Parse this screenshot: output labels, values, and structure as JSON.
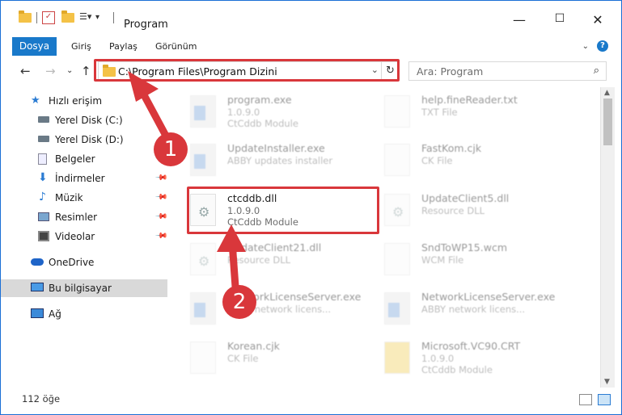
{
  "window": {
    "title": "Program",
    "minimize_icon": "minimize-icon",
    "maximize_icon": "maximize-icon",
    "close_icon": "close-icon"
  },
  "ribbon": {
    "tabs": [
      "Dosya",
      "Giriş",
      "Paylaş",
      "Görünüm"
    ],
    "help": "?"
  },
  "navbar": {
    "address": "C:\\Program Files\\Program Dizini",
    "search_placeholder": "Ara: Program"
  },
  "sidebar": {
    "items": [
      {
        "label": "Hızlı erişim",
        "icon": "star-icon"
      },
      {
        "label": "Yerel Disk (C:)",
        "icon": "drive-icon"
      },
      {
        "label": "Yerel Disk (D:)",
        "icon": "drive-icon"
      },
      {
        "label": "Belgeler",
        "icon": "documents-icon"
      },
      {
        "label": "İndirmeler",
        "icon": "download-icon"
      },
      {
        "label": "Müzik",
        "icon": "music-icon"
      },
      {
        "label": "Resimler",
        "icon": "pictures-icon"
      },
      {
        "label": "Videolar",
        "icon": "video-icon"
      },
      {
        "label": "OneDrive",
        "icon": "cloud-icon"
      },
      {
        "label": "Bu bilgisayar",
        "icon": "computer-icon"
      },
      {
        "label": "Ağ",
        "icon": "network-icon"
      }
    ]
  },
  "files": [
    {
      "name": "program.exe",
      "line1": "1.0.9.0",
      "line2": "CtCddb Module"
    },
    {
      "name": "help.fineReader.txt",
      "line1": "TXT File",
      "line2": ""
    },
    {
      "name": "UpdateInstaller.exe",
      "line1": "ABBY updates installer",
      "line2": ""
    },
    {
      "name": "FastKom.cjk",
      "line1": "CK File",
      "line2": ""
    },
    {
      "name": "ctcddb.dll",
      "line1": "1.0.9.0",
      "line2": "CtCddb Module"
    },
    {
      "name": "UpdateClient5.dll",
      "line1": "Resource DLL",
      "line2": ""
    },
    {
      "name": "UpdateClient21.dll",
      "line1": "Resource DLL",
      "line2": ""
    },
    {
      "name": "SndToWP15.wcm",
      "line1": "WCM File",
      "line2": ""
    },
    {
      "name": "NetworkLicenseServer.exe",
      "line1": "ABBY network licens...",
      "line2": ""
    },
    {
      "name": "NetworkLicenseServer.exe",
      "line1": "ABBY network licens...",
      "line2": ""
    },
    {
      "name": "Korean.cjk",
      "line1": "CK File",
      "line2": ""
    },
    {
      "name": "Microsoft.VC90.CRT",
      "line1": "1.0.9.0",
      "line2": "CtCddb Module"
    }
  ],
  "annotations": {
    "step1": "1",
    "step2": "2",
    "accent": "#d9373b"
  },
  "status": {
    "count": "112 öğe"
  }
}
